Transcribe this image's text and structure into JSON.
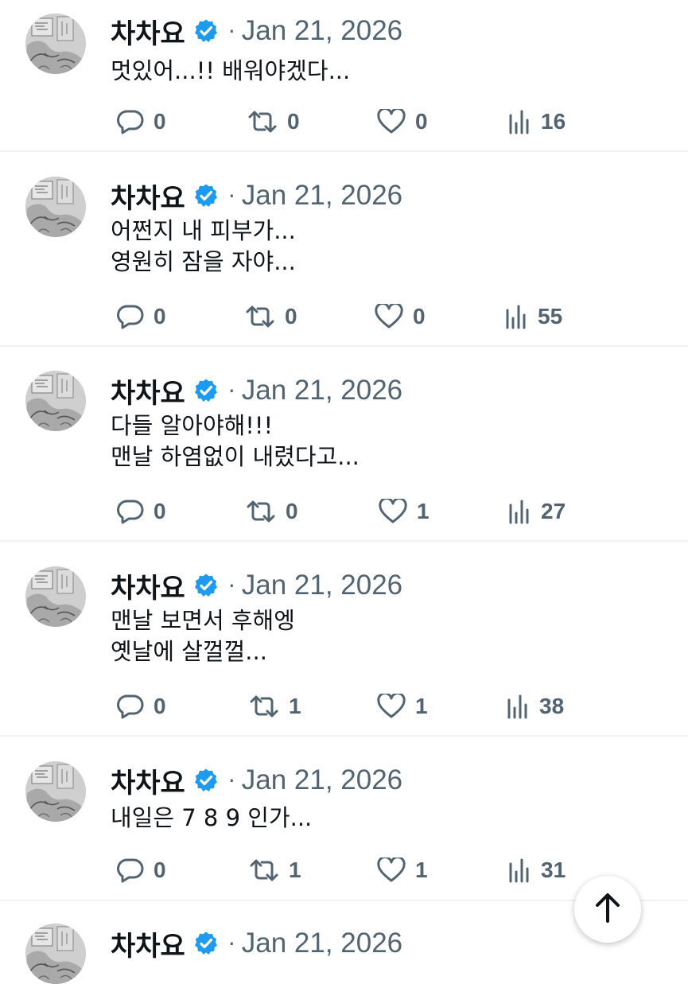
{
  "author": {
    "name": "차차요",
    "verified": true,
    "avatar_icon": "avatar-manga-sketch"
  },
  "separator": "·",
  "tweets": [
    {
      "date": "Jan 21, 2026",
      "lines": [
        "멋있어...!! 배워야겠다..."
      ],
      "replies": "0",
      "retweets": "0",
      "likes": "0",
      "views": "16"
    },
    {
      "date": "Jan 21, 2026",
      "lines": [
        "어쩐지 내 피부가...",
        "영원히 잠을 자야..."
      ],
      "replies": "0",
      "retweets": "0",
      "likes": "0",
      "views": "55"
    },
    {
      "date": "Jan 21, 2026",
      "lines": [
        "다들 알아야해!!!",
        "맨날 하염없이 내렸다고..."
      ],
      "replies": "0",
      "retweets": "0",
      "likes": "1",
      "views": "27"
    },
    {
      "date": "Jan 21, 2026",
      "lines": [
        "맨날 보면서 후해엥",
        "옛날에 살껄껄..."
      ],
      "replies": "0",
      "retweets": "1",
      "likes": "1",
      "views": "38"
    },
    {
      "date": "Jan 21, 2026",
      "lines": [
        "내일은 7 8 9 인가..."
      ],
      "replies": "0",
      "retweets": "1",
      "likes": "1",
      "views": "31"
    },
    {
      "date": "Jan 21, 2026",
      "lines": [],
      "replies": "",
      "retweets": "",
      "likes": "",
      "views": ""
    }
  ],
  "icons": {
    "reply": "reply-bubble-icon",
    "retweet": "retweet-icon",
    "like": "heart-icon",
    "views": "views-bar-chart-icon",
    "verified": "verified-badge-icon",
    "scroll_top": "arrow-up-icon"
  },
  "colors": {
    "verified": "#1d9bf0",
    "muted": "#536471",
    "text": "#0f1419",
    "divider": "#eff3f4"
  }
}
